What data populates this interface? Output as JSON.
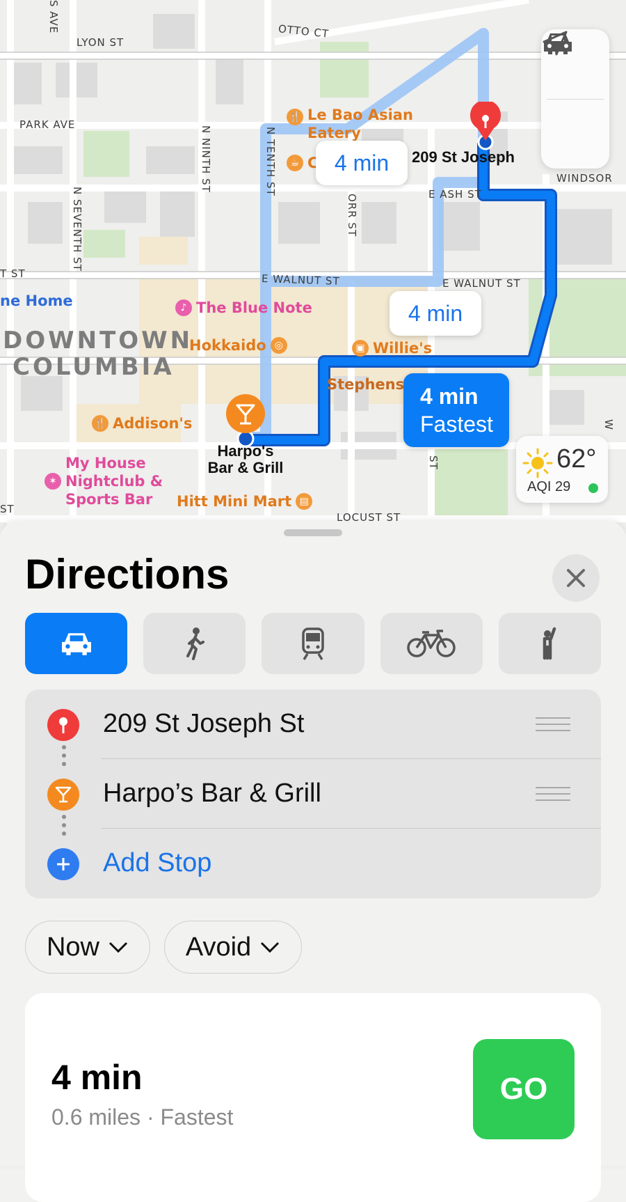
{
  "map": {
    "streets": {
      "lyon": "LYON ST",
      "otto": "OTTO CT",
      "park": "PARK AVE",
      "ninth": "N NINTH ST",
      "tenth": "N TENTH ST",
      "seventh": "N SEVENTH ST",
      "orr": "ORR ST",
      "ash": "E ASH ST",
      "walnut_w": "E WALNUT ST",
      "walnut_e": "E WALNUT ST",
      "windsor": "WINDSOR",
      "locust": "LOCUST ST",
      "ave_top": "S AVE",
      "st_left1": "T ST",
      "st_left2": "ST",
      "st_vert": "ST",
      "w_vert": "W"
    },
    "district": {
      "line1": "DOWNTOWN",
      "line2": "COLUMBIA"
    },
    "pois": {
      "le_bao": "Le Bao Asian Eatery",
      "le_bao_line1": "Le Bao Asian",
      "le_bao_line2": "Eatery",
      "blue_note": "The Blue Note",
      "hokkaido": "Hokkaido",
      "willies": "Willie's",
      "stephens": "Stephens",
      "addisons": "Addison's",
      "my_house_1": "My House",
      "my_house_2": "Nightclub &",
      "my_house_3": "Sports Bar",
      "hitt": "Hitt Mini Mart",
      "home": "ne Home",
      "cafe_partial": "C"
    },
    "pins": {
      "destination_label": "209 St Joseph",
      "origin_line1": "Harpo's",
      "origin_line2": "Bar & Grill"
    },
    "route_bubbles": {
      "alt1": "4 min",
      "alt2": "4 min",
      "fastest_time": "4 min",
      "fastest_label": "Fastest"
    },
    "controls": {
      "top_icon": "car-icon",
      "bottom_icon": "location-arrow-icon"
    },
    "weather": {
      "temp": "62°",
      "aqi": "AQI 29",
      "aqi_color": "#2bc35a"
    },
    "colors": {
      "route": "#0a7cf5",
      "alt_route": "#9cc4f5",
      "pin_red": "#f03b3b",
      "pin_orange": "#f48a1f"
    }
  },
  "sheet": {
    "title": "Directions",
    "close_icon": "close-icon",
    "modes": [
      {
        "name": "drive",
        "icon": "car-icon",
        "active": true
      },
      {
        "name": "walk",
        "icon": "walking-icon",
        "active": false
      },
      {
        "name": "transit",
        "icon": "train-icon",
        "active": false
      },
      {
        "name": "cycle",
        "icon": "bicycle-icon",
        "active": false
      },
      {
        "name": "rideshare",
        "icon": "hailing-person-icon",
        "active": false
      }
    ],
    "stops": [
      {
        "label": "209 St Joseph St",
        "icon": "pin-icon",
        "color": "#f03b3b"
      },
      {
        "label": "Harpo’s Bar & Grill",
        "icon": "cocktail-icon",
        "color": "#f48a1f"
      }
    ],
    "add_stop": "Add Stop",
    "options": {
      "time": "Now",
      "avoid": "Avoid"
    },
    "route": {
      "time": "4 min",
      "details": "0.6 miles · Fastest",
      "go": "GO",
      "go_color": "#2ecc55"
    }
  }
}
